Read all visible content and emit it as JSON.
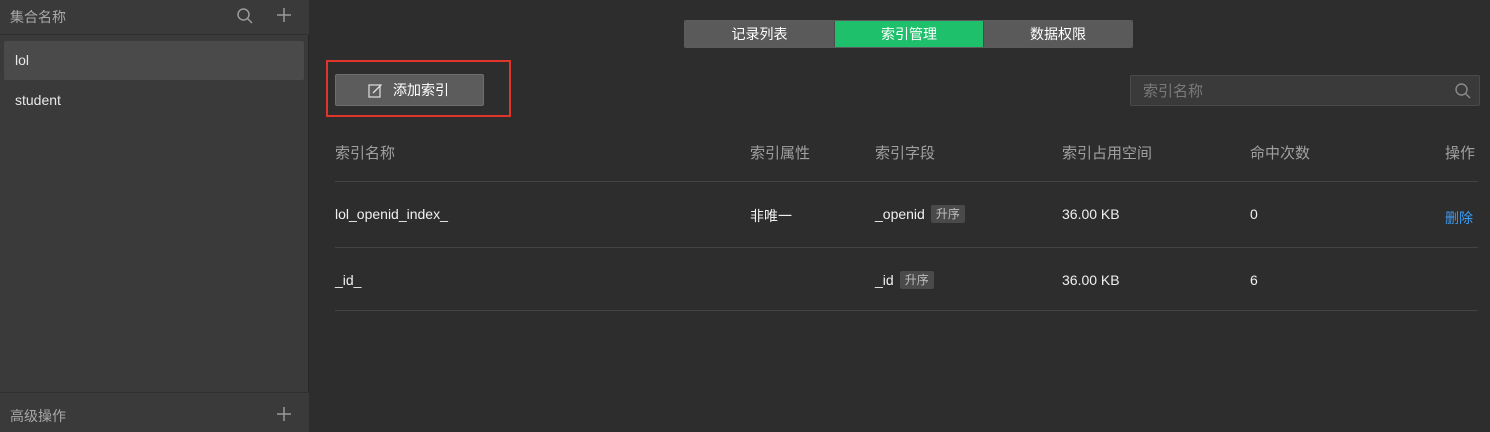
{
  "sidebar": {
    "title": "集合名称",
    "items": [
      {
        "label": "lol"
      },
      {
        "label": "student"
      }
    ],
    "footer_title": "高级操作"
  },
  "tabs": [
    {
      "label": "记录列表"
    },
    {
      "label": "索引管理"
    },
    {
      "label": "数据权限"
    }
  ],
  "toolbar": {
    "add_label": "添加索引",
    "search_placeholder": "索引名称"
  },
  "table": {
    "headers": [
      "索引名称",
      "索引属性",
      "索引字段",
      "索引占用空间",
      "命中次数",
      "操作"
    ],
    "rows": [
      {
        "name": "lol_openid_index_",
        "attr": "非唯一",
        "field": "_openid",
        "order": "升序",
        "size": "36.00 KB",
        "hits": "0",
        "action": "删除"
      },
      {
        "name": "_id_",
        "attr": "",
        "field": "_id",
        "order": "升序",
        "size": "36.00 KB",
        "hits": "6",
        "action": ""
      }
    ]
  },
  "colors": {
    "accent": "#1fc06b",
    "link": "#3c9cf2",
    "highlight": "#e0352b"
  }
}
